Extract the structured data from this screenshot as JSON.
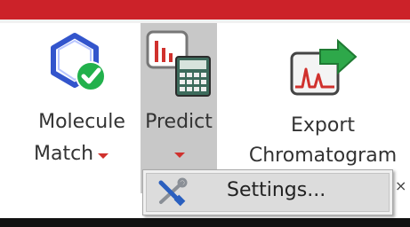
{
  "ribbon": {
    "buttons": [
      {
        "label_line1": "Molecule",
        "label_line2": "Match",
        "icon": "molecule-check-icon",
        "has_dropdown": true
      },
      {
        "label_line1": "Predict",
        "icon": "predict-calculator-icon",
        "has_dropdown": true,
        "state": "pressed"
      },
      {
        "label_line1": "Export",
        "label_line2": "Chromatogram",
        "icon": "export-chromatogram-icon",
        "has_dropdown": false
      }
    ]
  },
  "dropdown_menu": {
    "items": [
      {
        "label": "Settings...",
        "icon": "settings-tools-icon",
        "highlighted": true
      }
    ]
  },
  "colors": {
    "title_bar": "#cc2229",
    "pressed_button": "#c8c8c8",
    "dropdown_arrow": "#d0312d",
    "check_badge": "#22b14c",
    "molecule_outline": "#3355cc"
  }
}
